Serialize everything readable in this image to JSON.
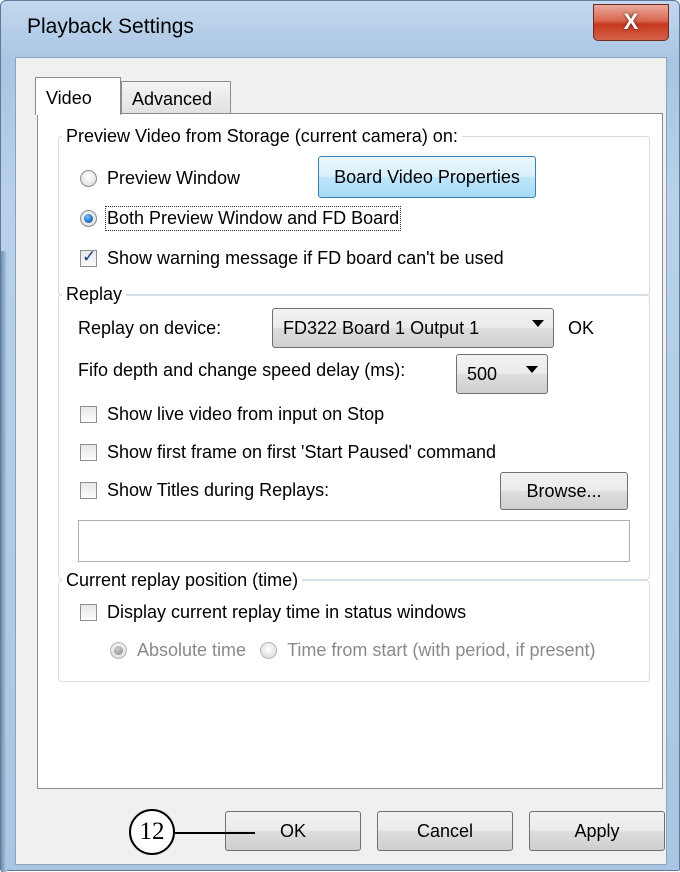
{
  "window": {
    "title": "Playback Settings",
    "close_label": "X"
  },
  "tabs": [
    {
      "label": "Video",
      "active": true
    },
    {
      "label": "Advanced",
      "active": false
    }
  ],
  "preview_group": {
    "title": "Preview Video from Storage (current camera) on:",
    "preview_window_label": "Preview Window",
    "board_video_properties_label": "Board Video Properties",
    "both_label": "Both Preview Window and FD Board",
    "show_warning_label": "Show warning message if FD board can't be used",
    "selected": "both",
    "show_warning_checked": true
  },
  "replay_group": {
    "title": "Replay",
    "device_label": "Replay on device:",
    "device_value": "FD322 Board 1 Output 1",
    "device_status": "OK",
    "fifo_label": "Fifo depth and change speed delay (ms):",
    "fifo_value": "500",
    "live_video_label": "Show live video from input on Stop",
    "first_frame_label": "Show first frame on first 'Start Paused' command",
    "titles_label": "Show Titles during Replays:",
    "browse_label": "Browse...",
    "titles_path": ""
  },
  "position_group": {
    "title": "Current replay position (time)",
    "display_label": "Display current replay time in status windows",
    "absolute_label": "Absolute time",
    "from_start_label": "Time from start (with period, if present)"
  },
  "footer": {
    "ok_label": "OK",
    "cancel_label": "Cancel",
    "apply_label": "Apply"
  },
  "callout": {
    "number": "12"
  },
  "colors": {
    "accent": "#3c7fb1",
    "close_red": "#c4381f",
    "frame_blue": "#a9c5e3"
  }
}
